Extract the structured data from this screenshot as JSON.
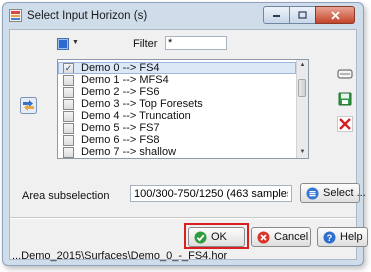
{
  "window": {
    "title": "Select Input Horizon (s)"
  },
  "filter": {
    "label": "Filter",
    "value": "*"
  },
  "horizons": [
    {
      "label": "Demo 0 --> FS4",
      "checked": true
    },
    {
      "label": "Demo 1 --> MFS4",
      "checked": false
    },
    {
      "label": "Demo 2 --> FS6",
      "checked": false
    },
    {
      "label": "Demo 3 --> Top Foresets",
      "checked": false
    },
    {
      "label": "Demo 4 --> Truncation",
      "checked": false
    },
    {
      "label": "Demo 5 --> FS7",
      "checked": false
    },
    {
      "label": "Demo 6 --> FS8",
      "checked": false
    },
    {
      "label": "Demo 7 --> shallow",
      "checked": false
    }
  ],
  "area": {
    "label": "Area subselection",
    "value": "100/300-750/1250 (463 samples)",
    "select_label": "Select ..."
  },
  "buttons": {
    "ok_label": "OK",
    "cancel_label": "Cancel",
    "help_label": "Help"
  },
  "status": {
    "path": "...Demo_2015\\Surfaces\\Demo_0_-_FS4.hor"
  },
  "colors": {
    "highlight": "#d8201f",
    "title_bar": "#cfdcea"
  }
}
